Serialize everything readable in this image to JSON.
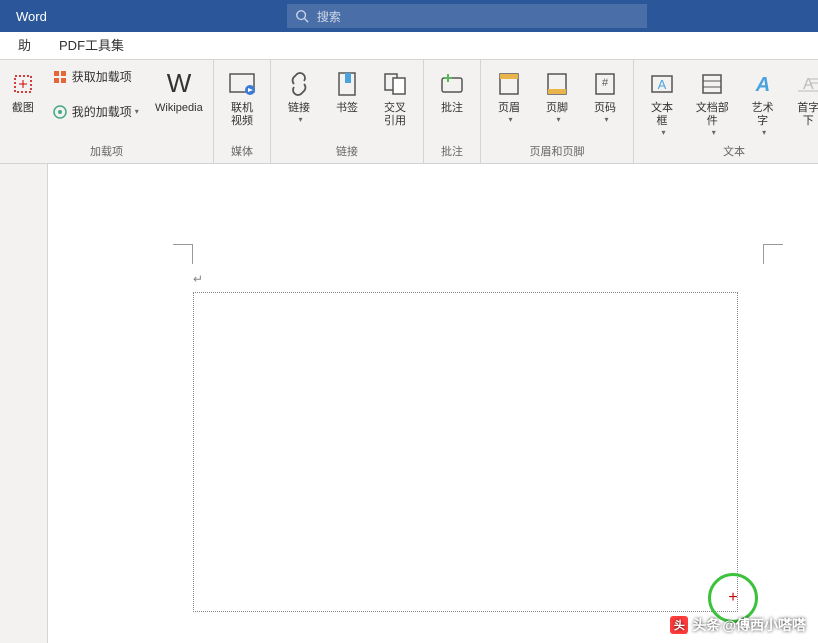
{
  "title": "Word",
  "search": {
    "placeholder": "搜索"
  },
  "tabs": [
    {
      "label": "助"
    },
    {
      "label": "PDF工具集"
    }
  ],
  "ribbon": {
    "groups": [
      {
        "label": "加载项",
        "left_buttons": [
          {
            "label": "截图",
            "icon": "screenshot"
          }
        ],
        "stack": [
          {
            "label": "获取加载项",
            "icon": "store"
          },
          {
            "label": "我的加载项",
            "icon": "addins",
            "dropdown": true
          }
        ],
        "right_buttons": [
          {
            "label": "Wikipedia",
            "icon": "wikipedia"
          }
        ]
      },
      {
        "label": "媒体",
        "buttons": [
          {
            "label": "联机视频",
            "icon": "video"
          }
        ]
      },
      {
        "label": "链接",
        "buttons": [
          {
            "label": "链接",
            "icon": "link",
            "dropdown": true
          },
          {
            "label": "书签",
            "icon": "bookmark"
          },
          {
            "label": "交叉引用",
            "icon": "crossref"
          }
        ]
      },
      {
        "label": "批注",
        "buttons": [
          {
            "label": "批注",
            "icon": "comment"
          }
        ]
      },
      {
        "label": "页眉和页脚",
        "buttons": [
          {
            "label": "页眉",
            "icon": "header",
            "dropdown": true
          },
          {
            "label": "页脚",
            "icon": "footer",
            "dropdown": true
          },
          {
            "label": "页码",
            "icon": "pagenum",
            "dropdown": true
          }
        ]
      },
      {
        "label": "文本",
        "buttons": [
          {
            "label": "文本框",
            "icon": "textbox",
            "dropdown": true
          },
          {
            "label": "文档部件",
            "icon": "docparts",
            "dropdown": true
          },
          {
            "label": "艺术字",
            "icon": "wordart",
            "dropdown": true
          },
          {
            "label": "首字下",
            "icon": "dropcap"
          }
        ]
      }
    ]
  },
  "watermark": {
    "prefix": "头条",
    "handle": "@傅西小嗒嗒"
  }
}
